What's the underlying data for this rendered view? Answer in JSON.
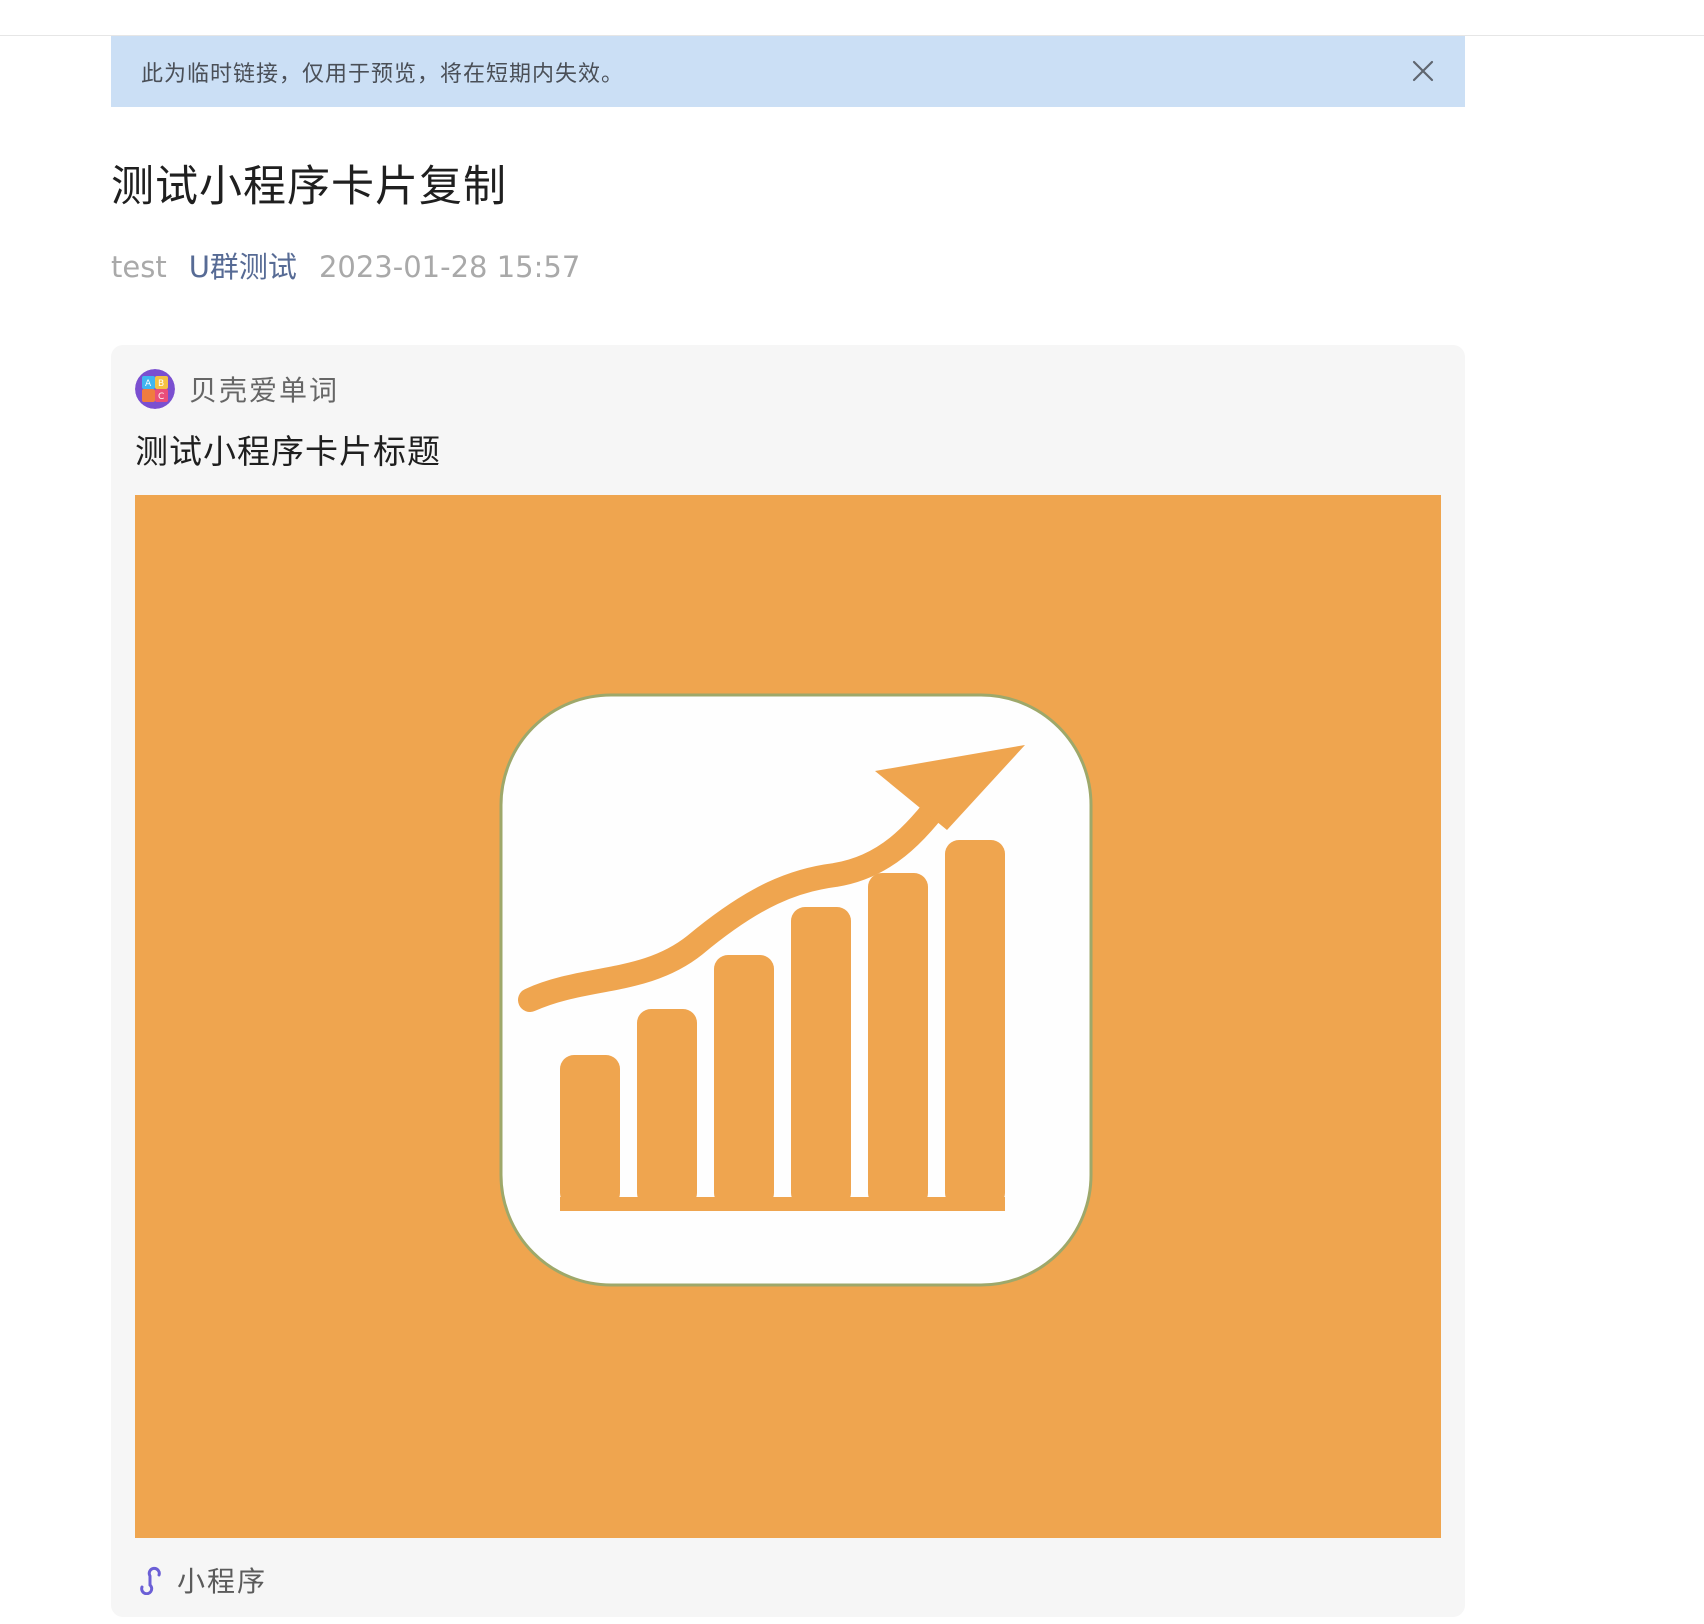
{
  "notice": {
    "text": "此为临时链接，仅用于预览，将在短期内失效。",
    "close_icon": "close-icon"
  },
  "article": {
    "title": "测试小程序卡片复制",
    "author": "test",
    "group": "U群测试",
    "datetime": "2023-01-28 15:57"
  },
  "miniprogram_card": {
    "app_name": "贝壳爱单词",
    "title": "测试小程序卡片标题",
    "footer_label": "小程序",
    "footer_icon": "miniprogram-link-icon",
    "image_icon": "growth-chart-icon"
  },
  "colors": {
    "notice_bg": "#cbdff5",
    "link": "#576b95",
    "image_bg": "#efa54f",
    "card_bg": "#f6f6f6"
  }
}
